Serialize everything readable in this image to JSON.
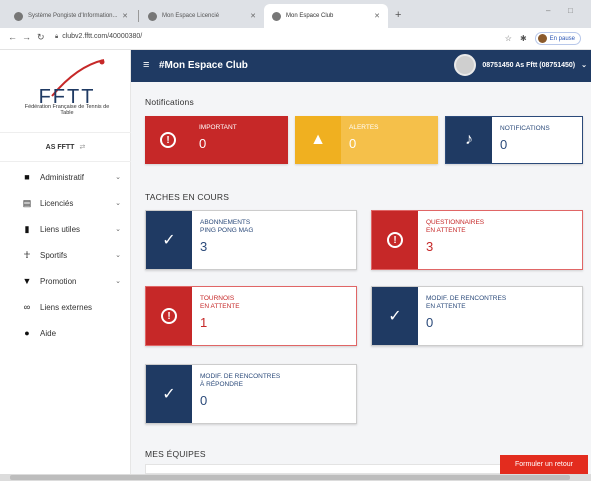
{
  "browser": {
    "tabs": [
      {
        "label": "Système Pongiste d'Information...",
        "active": false
      },
      {
        "label": "Mon Espace Licencié",
        "active": false
      },
      {
        "label": "Mon Espace Club",
        "active": true
      }
    ],
    "url": "clubv2.fftt.com/40000380/",
    "profile_label": "En pause",
    "new_tab": "+",
    "minimize": "–",
    "maximize": "□"
  },
  "app": {
    "title": "#Mon Espace Club",
    "user_label": "08751450 As Fftt (08751450)",
    "colors": {
      "navy": "#1f3a63",
      "red": "#c62828",
      "yellow": "#f5c04a",
      "blue": "#2b4a7a"
    }
  },
  "sidebar": {
    "logo_text": "FFTT",
    "logo_subtitle": "Fédération Française de Tennis de Table",
    "club_name": "AS FFTT",
    "items": [
      {
        "label": "Administratif",
        "icon": "briefcase-icon",
        "has_chevron": true
      },
      {
        "label": "Licenciés",
        "icon": "id-card-icon",
        "has_chevron": true
      },
      {
        "label": "Liens utiles",
        "icon": "bookmark-icon",
        "has_chevron": true
      },
      {
        "label": "Sportifs",
        "icon": "runner-icon",
        "has_chevron": true
      },
      {
        "label": "Promotion",
        "icon": "megaphone-icon",
        "has_chevron": true
      },
      {
        "label": "Liens externes",
        "icon": "link-icon",
        "has_chevron": false
      },
      {
        "label": "Aide",
        "icon": "question-icon",
        "has_chevron": false
      }
    ]
  },
  "notifications": {
    "section_title": "Notifications",
    "cards": [
      {
        "label": "IMPORTANT",
        "value": "0"
      },
      {
        "label": "ALERTES",
        "value": "0"
      },
      {
        "label": "NOTIFICATIONS",
        "value": "0"
      }
    ]
  },
  "tasks": {
    "section_title": "TACHES EN COURS",
    "cards": [
      {
        "label_line1": "ABONNEMENTS",
        "label_line2": "PING PONG MAG",
        "value": "3"
      },
      {
        "label_line1": "QUESTIONNAIRES",
        "label_line2": "EN ATTENTE",
        "value": "3"
      },
      {
        "label_line1": "TOURNOIS",
        "label_line2": "EN ATTENTE",
        "value": "1"
      },
      {
        "label_line1": "MODIF. DE RENCONTRES",
        "label_line2": "EN ATTENTE",
        "value": "0"
      },
      {
        "label_line1": "MODIF. DE RENCONTRES",
        "label_line2": "À RÉPONDRE",
        "value": "0"
      }
    ]
  },
  "teams": {
    "section_title": "MES ÉQUIPES"
  },
  "feedback_button": "Formuler un retour"
}
